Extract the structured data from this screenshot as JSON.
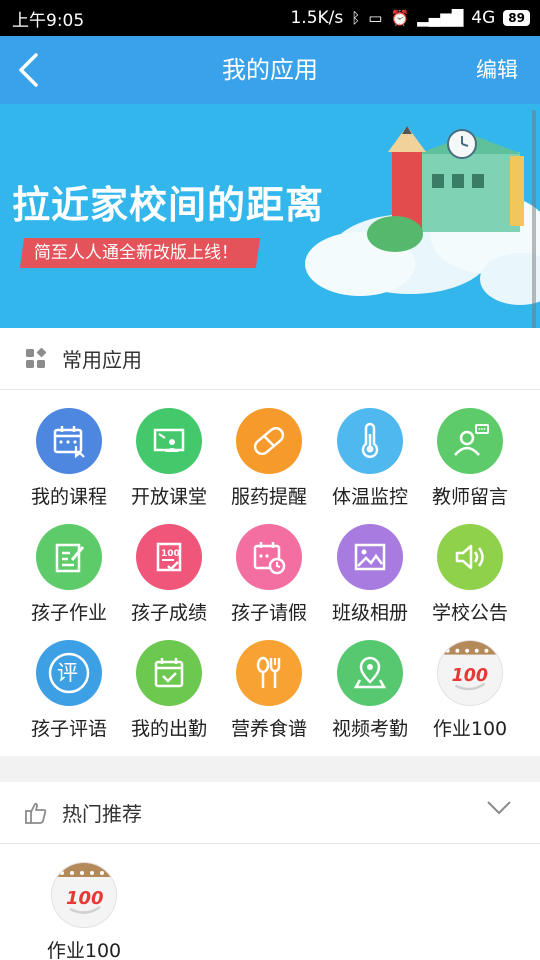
{
  "status_bar": {
    "time": "上午9:05",
    "net_speed": "1.5K/s",
    "network": "4G",
    "battery": "89"
  },
  "navbar": {
    "title": "我的应用",
    "edit_label": "编辑"
  },
  "banner": {
    "title": "拉近家校间的距离",
    "subtitle": "简至人人通全新改版上线！"
  },
  "common_apps": {
    "header": "常用应用",
    "items": [
      {
        "label": "我的课程",
        "icon": "calendar-touch-icon",
        "color": "#4e87e0"
      },
      {
        "label": "开放课堂",
        "icon": "classroom-screen-icon",
        "color": "#43c96b"
      },
      {
        "label": "服药提醒",
        "icon": "pill-icon",
        "color": "#f79a2c"
      },
      {
        "label": "体温监控",
        "icon": "thermometer-icon",
        "color": "#4fb8ee"
      },
      {
        "label": "教师留言",
        "icon": "teacher-message-icon",
        "color": "#5dcb6a"
      },
      {
        "label": "孩子作业",
        "icon": "homework-edit-icon",
        "color": "#5dcb6a"
      },
      {
        "label": "孩子成绩",
        "icon": "score-100-icon",
        "color": "#f0567a"
      },
      {
        "label": "孩子请假",
        "icon": "calendar-clock-icon",
        "color": "#f46fa1"
      },
      {
        "label": "班级相册",
        "icon": "photo-album-icon",
        "color": "#a77be0"
      },
      {
        "label": "学校公告",
        "icon": "speaker-icon",
        "color": "#8fd14a"
      },
      {
        "label": "孩子评语",
        "icon": "comment-ping-icon",
        "color": "#3d9fe4"
      },
      {
        "label": "我的出勤",
        "icon": "calendar-check-icon",
        "color": "#6cc84f"
      },
      {
        "label": "营养食谱",
        "icon": "spoon-fork-icon",
        "color": "#f7a233"
      },
      {
        "label": "视频考勤",
        "icon": "location-pin-icon",
        "color": "#56c970"
      },
      {
        "label": "作业100",
        "icon": "zuoye100-logo-icon",
        "color": "#ececec"
      }
    ]
  },
  "hot_recommend": {
    "header": "热门推荐",
    "items": [
      {
        "label": "作业100",
        "icon": "zuoye100-logo-icon"
      }
    ]
  }
}
